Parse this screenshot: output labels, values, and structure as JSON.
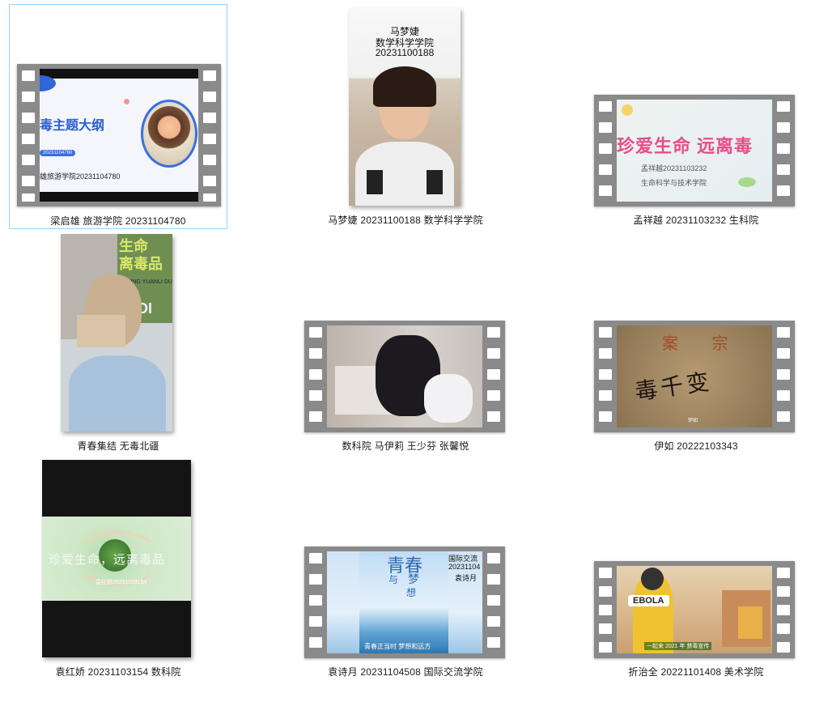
{
  "items": [
    {
      "caption": "梁启雄 旅游学院 20231104780",
      "overlay": {
        "title": "毒主题大纲",
        "code": "20231104780",
        "org": "雄旅游学院20231104780"
      }
    },
    {
      "caption": "马梦婕 20231100188 数学科学学院",
      "overlay": {
        "line1": "马梦婕",
        "line2": "数学科学学院",
        "line3": "20231100188"
      }
    },
    {
      "caption": "孟祥越 20231103232 生科院",
      "overlay": {
        "title": "珍爱生命 远离毒",
        "sub1": "孟祥越20231103232",
        "sub2": "生命科学与技术学院"
      }
    },
    {
      "caption": "青春集结 无毒北疆",
      "overlay": {
        "banner": "生命\n离毒品",
        "sub": "NGMING YUANLI DU",
        "tag": "IDI"
      }
    },
    {
      "caption": "数科院 马伊莉 王少芬 张馨悦",
      "overlay": {}
    },
    {
      "caption": "伊如 20222103343",
      "overlay": {
        "top": "案 宗",
        "main": "毒千变",
        "small": "伊如"
      }
    },
    {
      "caption": "袁红娇 20231103154 数科院",
      "overlay": {
        "main": "珍爱生命，远离毒品",
        "small": "袁红娇20231103154"
      }
    },
    {
      "caption": "袁诗月 20231104508 国际交流学院",
      "overlay": {
        "title1": "青春",
        "title2": "与",
        "title3": "梦",
        "title4": "想",
        "side1": "国际交流",
        "side2": "20231104",
        "side3": "袁诗月",
        "bottom": "青春正当时 梦想和远方"
      }
    },
    {
      "caption": "折治全 20221101408 美术学院",
      "overlay": {
        "badge": "EBOLA",
        "bottom": "一起来 2021 年 禁毒宣传"
      }
    }
  ],
  "colors": {
    "selection_border": "#99d1ff",
    "film": "#8a8a8a"
  }
}
